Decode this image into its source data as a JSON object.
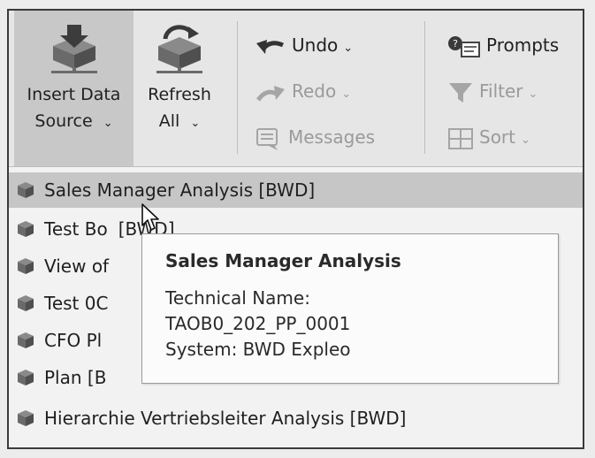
{
  "ribbon": {
    "insert_data_source": {
      "line1": "Insert Data",
      "line2": "Source",
      "chevron": "⌄",
      "icon": "cube-download-icon"
    },
    "refresh_all": {
      "line1": "Refresh",
      "line2": "All",
      "chevron": "⌄",
      "icon": "cube-refresh-icon"
    },
    "undo": {
      "label": "Undo",
      "chevron": "⌄",
      "icon": "undo-icon"
    },
    "redo": {
      "label": "Redo",
      "chevron": "⌄",
      "icon": "redo-icon",
      "disabled": true
    },
    "messages": {
      "label": "Messages",
      "icon": "messages-icon",
      "disabled": true
    },
    "prompts": {
      "label": "Prompts",
      "icon": "prompts-icon"
    },
    "filter": {
      "label": "Filter",
      "chevron": "⌄",
      "icon": "filter-icon",
      "disabled": true
    },
    "sort": {
      "label": "Sort",
      "chevron": "⌄",
      "icon": "sort-icon",
      "disabled": true
    }
  },
  "menu": {
    "items": [
      {
        "label": "Sales Manager Analysis [BWD]",
        "selected": true
      },
      {
        "label": "Test Bo"
      },
      {
        "label": "View of"
      },
      {
        "label": "Test 0C"
      },
      {
        "label": "CFO Pl"
      },
      {
        "label": "Plan [B"
      },
      {
        "label": "Hierarchie Vertriebsleiter Analysis [BWD]"
      }
    ],
    "item2_tail": "[BWD]"
  },
  "tooltip": {
    "title": "Sales Manager Analysis",
    "tech_label": "Technical Name:",
    "tech_value": "TAOB0_202_PP_0001",
    "system": "System: BWD Expleo"
  },
  "colors": {
    "cube_top": "#7a7a7a",
    "cube_side": "#5c5c5c",
    "selection": "#c6c6c6",
    "ribbon_bg": "#e6e6e6"
  }
}
